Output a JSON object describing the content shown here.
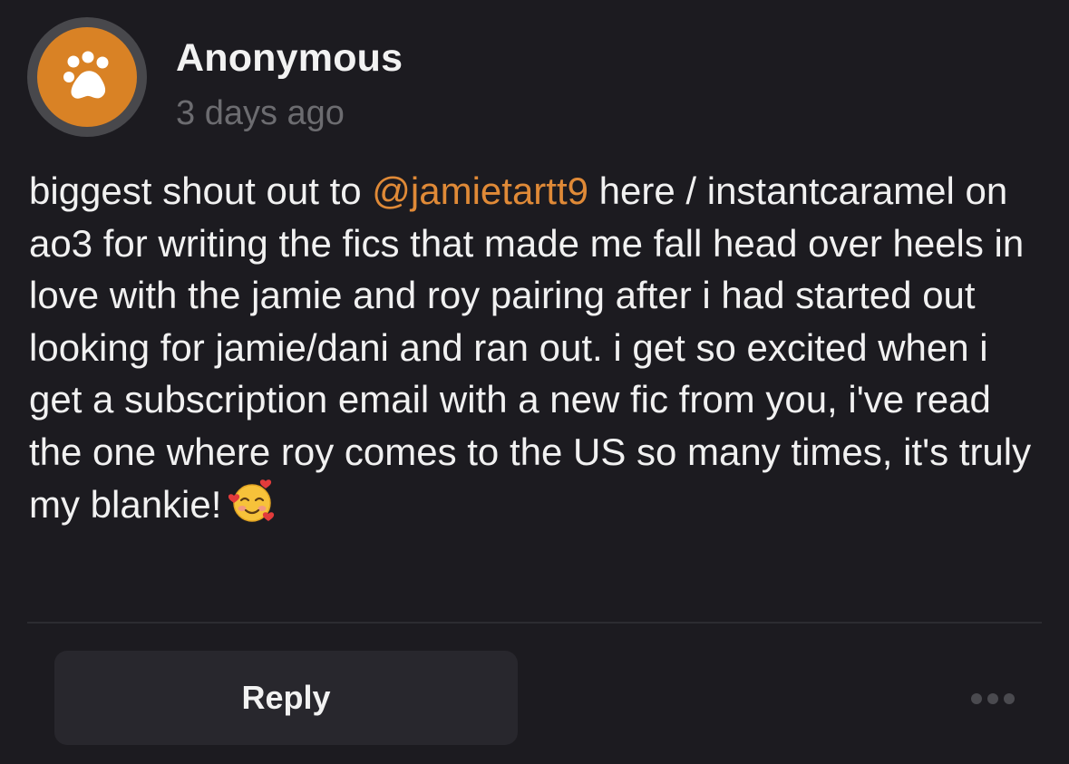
{
  "post": {
    "author": "Anonymous",
    "timestamp": "3 days ago",
    "avatar_icon": "paw-icon",
    "avatar_color": "#d98225",
    "message": {
      "before_mention": "biggest shout out to ",
      "mention": "@jamietartt9",
      "after_mention": " here / instantcaramel on ao3 for writing the fics that made me fall head over heels in love with the jamie and roy pairing after i had started out looking for jamie/dani and ran out. i get so excited when i get a subscription email with a new fic from you, i've read the one where roy comes to the US so many times, it's truly my blankie!",
      "emoji": "smiling-face-with-hearts-emoji"
    },
    "mention_color": "#e08a37"
  },
  "actions": {
    "reply_label": "Reply",
    "more_icon": "more-icon"
  }
}
